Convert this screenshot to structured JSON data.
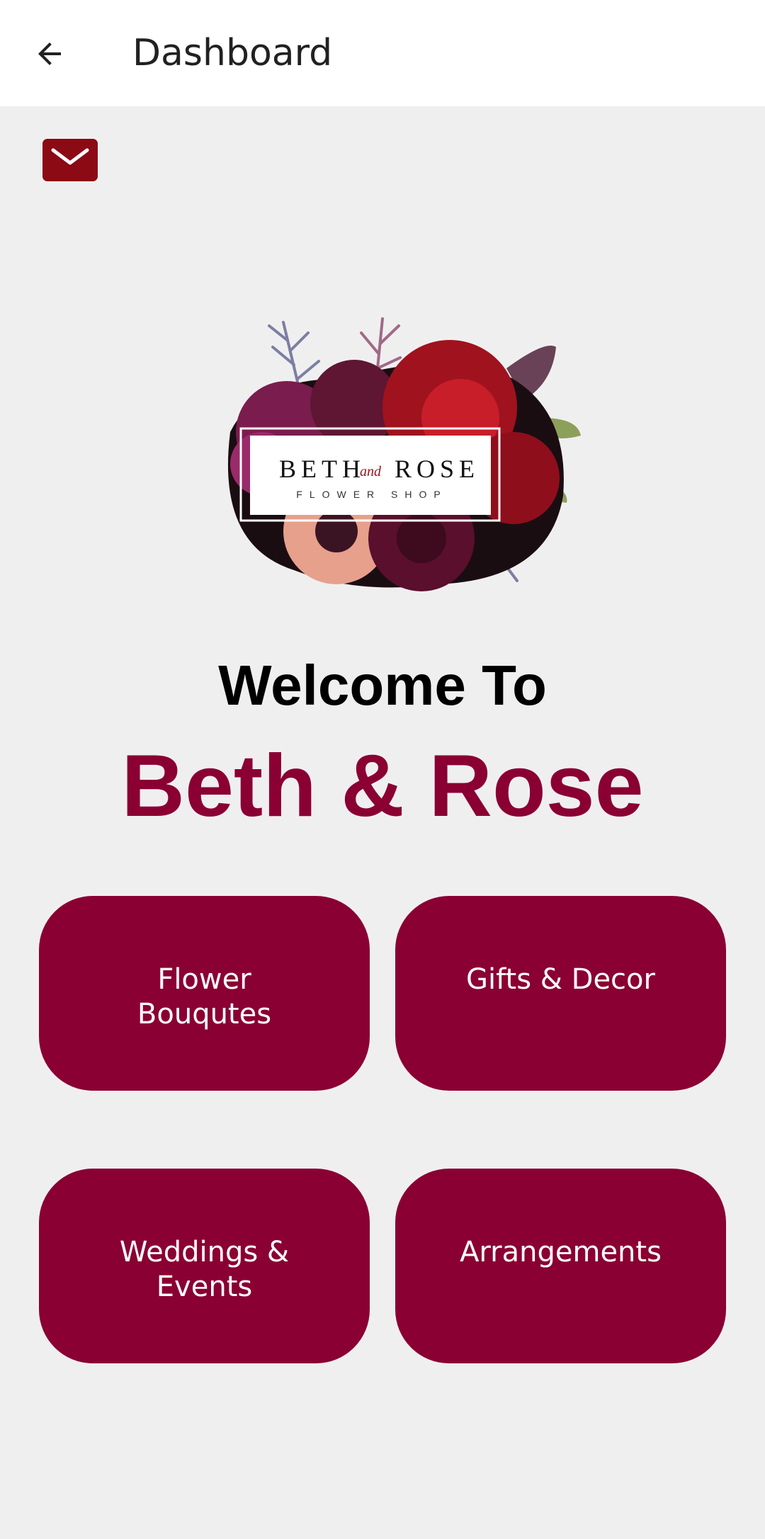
{
  "appbar": {
    "title": "Dashboard",
    "back_icon": "arrow-left-icon"
  },
  "mail_button": {
    "icon": "mail-icon",
    "color": "#8b0a14"
  },
  "logo": {
    "name": "BETH",
    "and": "and",
    "name2": "ROSE",
    "subtitle": "FLOWER SHOP"
  },
  "welcome": {
    "line1": "Welcome To",
    "line2": "Beth & Rose",
    "brand_color": "#8a0032"
  },
  "cards": [
    {
      "label": "Flower Bouqutes"
    },
    {
      "label": "Gifts & Decor"
    },
    {
      "label": "Weddings & Events"
    },
    {
      "label": "Arrangements"
    }
  ]
}
